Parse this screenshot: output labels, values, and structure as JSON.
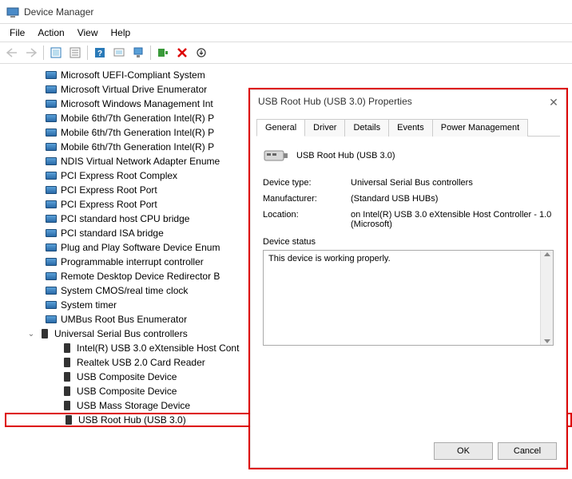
{
  "window": {
    "title": "Device Manager"
  },
  "menu": {
    "file": "File",
    "action": "Action",
    "view": "View",
    "help": "Help"
  },
  "tree": {
    "items": [
      "Microsoft UEFI-Compliant System",
      "Microsoft Virtual Drive Enumerator",
      "Microsoft Windows Management Int",
      "Mobile 6th/7th Generation Intel(R) P",
      "Mobile 6th/7th Generation Intel(R) P",
      "Mobile 6th/7th Generation Intel(R) P",
      "NDIS Virtual Network Adapter Enume",
      "PCI Express Root Complex",
      "PCI Express Root Port",
      "PCI Express Root Port",
      "PCI standard host CPU bridge",
      "PCI standard ISA bridge",
      "Plug and Play Software Device Enum",
      "Programmable interrupt controller",
      "Remote Desktop Device Redirector B",
      "System CMOS/real time clock",
      "System timer",
      "UMBus Root Bus Enumerator"
    ],
    "usb_category": "Universal Serial Bus controllers",
    "usb_children": [
      "Intel(R) USB 3.0 eXtensible Host Cont",
      "Realtek USB 2.0 Card Reader",
      "USB Composite Device",
      "USB Composite Device",
      "USB Mass Storage Device",
      "USB Root Hub (USB 3.0)"
    ]
  },
  "dialog": {
    "title": "USB Root Hub (USB 3.0) Properties",
    "tabs": {
      "general": "General",
      "driver": "Driver",
      "details": "Details",
      "events": "Events",
      "power": "Power Management"
    },
    "device_name": "USB Root Hub (USB 3.0)",
    "labels": {
      "device_type": "Device type:",
      "manufacturer": "Manufacturer:",
      "location": "Location:",
      "status": "Device status"
    },
    "values": {
      "device_type": "Universal Serial Bus controllers",
      "manufacturer": "(Standard USB HUBs)",
      "location": "on Intel(R) USB 3.0 eXtensible Host Controller - 1.0 (Microsoft)"
    },
    "status_text": "This device is working properly.",
    "buttons": {
      "ok": "OK",
      "cancel": "Cancel"
    }
  }
}
